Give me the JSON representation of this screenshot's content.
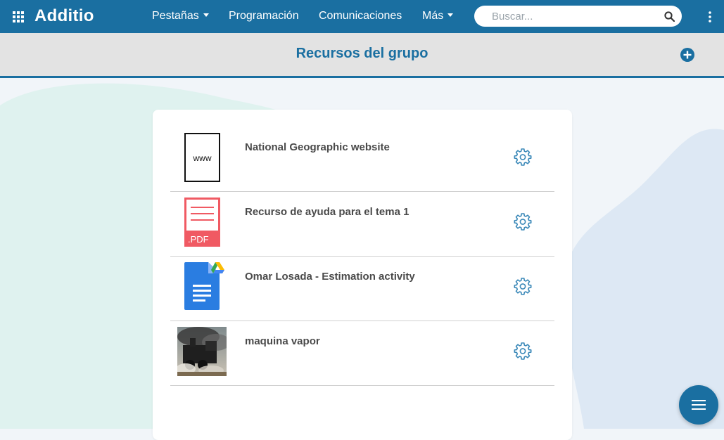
{
  "app": {
    "name": "Additio"
  },
  "nav": {
    "items": [
      {
        "label": "Pestañas",
        "dropdown": true
      },
      {
        "label": "Programación",
        "dropdown": false
      },
      {
        "label": "Comunicaciones",
        "dropdown": false
      },
      {
        "label": "Más",
        "dropdown": true
      }
    ]
  },
  "search": {
    "placeholder": "Buscar..."
  },
  "page": {
    "title": "Recursos del grupo"
  },
  "resources": [
    {
      "title": "National Geographic website",
      "type": "www",
      "icon": "www-link-icon",
      "icon_text": "www"
    },
    {
      "title": "Recurso de ayuda para el tema 1",
      "type": "pdf",
      "icon": "pdf-file-icon",
      "icon_text": ".PDF"
    },
    {
      "title": "Omar Losada - Estimation activity",
      "type": "google-doc",
      "icon": "google-docs-icon"
    },
    {
      "title": "maquina vapor",
      "type": "image",
      "icon": "steam-locomotive-photo"
    }
  ],
  "icons": {
    "apps": "apps-grid-icon",
    "search": "search-icon",
    "menu": "more-vertical-icon",
    "add": "add-circle-icon",
    "settings": "gear-icon",
    "fab": "hamburger-menu-icon"
  },
  "colors": {
    "primary": "#1a6fa1",
    "subheader_bg": "#e3e3e3",
    "pdf_red": "#f05a63",
    "gdoc_blue": "#2a7de1",
    "gear_blue": "#3a88b8"
  }
}
